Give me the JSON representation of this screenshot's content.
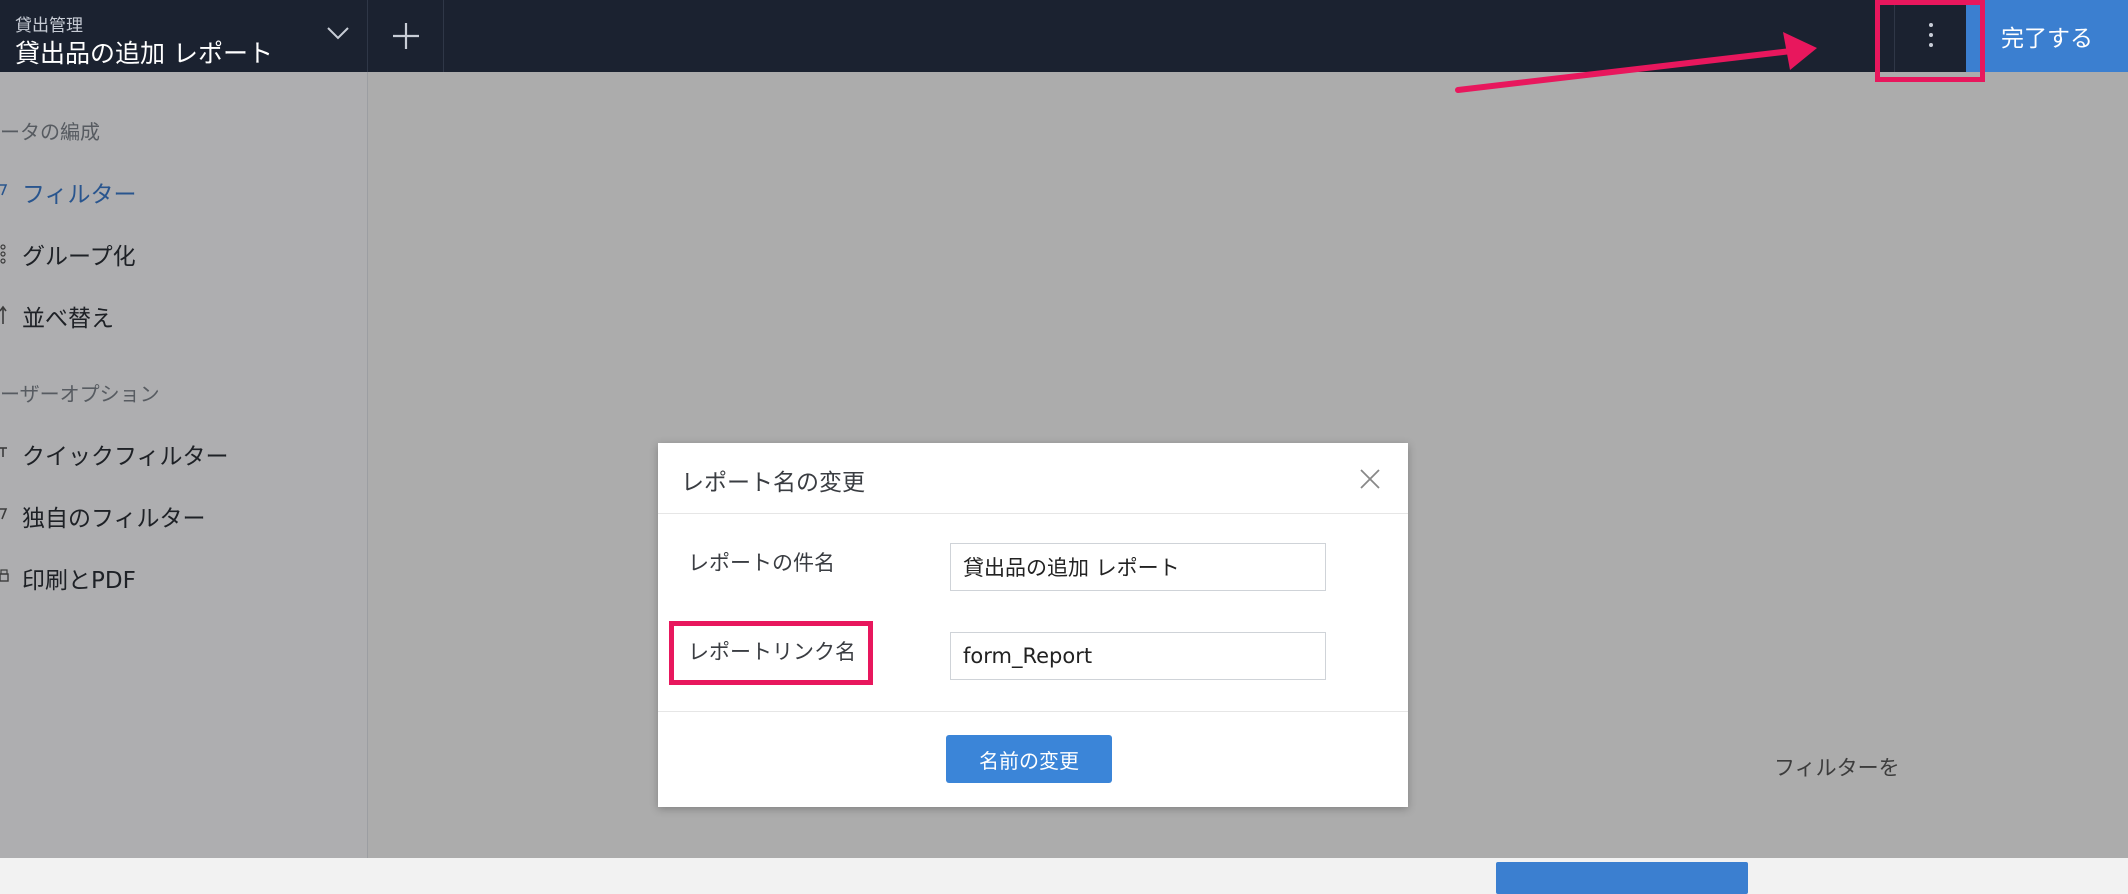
{
  "topbar": {
    "app_name": "貸出管理",
    "report_title": "貸出品の追加 レポート",
    "done_label": "完了する",
    "icons": {
      "chevron": "chevron-down-icon",
      "add": "plus-icon",
      "more": "more-vertical-icon"
    }
  },
  "sidebar": {
    "section_data": "ータの編成",
    "data_items": [
      {
        "label": "フィルター",
        "icon": "filter-icon",
        "active": true
      },
      {
        "label": "グループ化",
        "icon": "group-icon"
      },
      {
        "label": "並べ替え",
        "icon": "sort-icon"
      }
    ],
    "section_user": "ーザーオプション",
    "user_items": [
      {
        "label": "クイックフィルター",
        "icon": "quick-filter-icon"
      },
      {
        "label": "独自のフィルター",
        "icon": "custom-filter-icon"
      },
      {
        "label": "印刷とPDF",
        "icon": "print-icon"
      }
    ]
  },
  "background": {
    "hint_text": "フィルターを"
  },
  "dialog": {
    "title": "レポート名の変更",
    "subject_label": "レポートの件名",
    "subject_value": "貸出品の追加 レポート",
    "link_label": "レポートリンク名",
    "link_value": "form_Report",
    "rename_button": "名前の変更"
  },
  "annotation": {
    "color": "#e8175d"
  },
  "colors": {
    "topbar": "#1b2230",
    "accent": "#3b7fd0",
    "active_link": "#3a78c8"
  }
}
